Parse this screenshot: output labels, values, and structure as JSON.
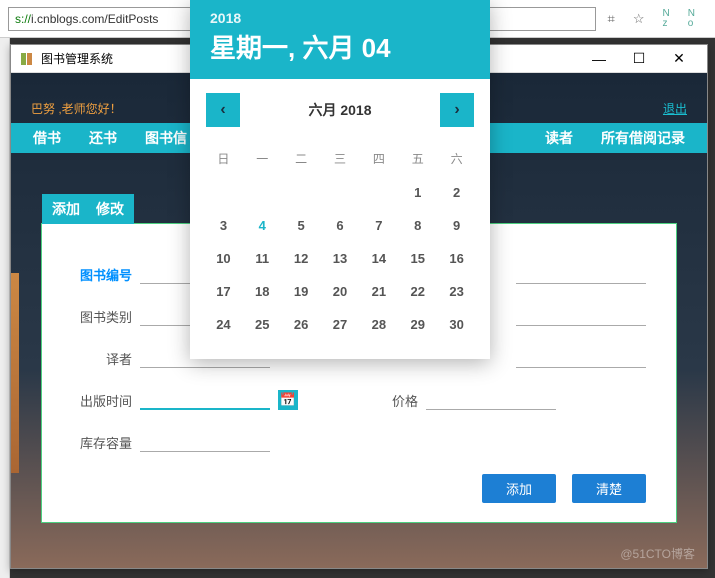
{
  "browser": {
    "url_prefix": "s://",
    "url_host": "i.cnblogs.com",
    "url_path": "/EditPosts",
    "qr_icon": "⌗",
    "star_icon": "☆"
  },
  "window": {
    "title": "图书管理系统"
  },
  "header": {
    "greeting": "巴努 ,老师您好！",
    "logout": "退出"
  },
  "nav": [
    "借书",
    "还书",
    "图书信",
    "读者",
    "所有借阅记录"
  ],
  "panel": {
    "tabs": [
      "添加",
      "修改"
    ],
    "fields": {
      "book_id": "图书编号",
      "category": "图书类别",
      "translator": "译者",
      "pub_date": "出版时间",
      "price": "价格",
      "stock": "库存容量"
    },
    "buttons": {
      "add": "添加",
      "clear": "清楚"
    }
  },
  "datepicker": {
    "year": "2018",
    "display_date": "星期一, 六月 04",
    "month_label": "六月 2018",
    "dow": [
      "日",
      "一",
      "二",
      "三",
      "四",
      "五",
      "六"
    ],
    "weeks": [
      [
        "",
        "",
        "",
        "",
        "",
        "1",
        "2"
      ],
      [
        "3",
        "4",
        "5",
        "6",
        "7",
        "8",
        "9"
      ],
      [
        "10",
        "11",
        "12",
        "13",
        "14",
        "15",
        "16"
      ],
      [
        "17",
        "18",
        "19",
        "20",
        "21",
        "22",
        "23"
      ],
      [
        "24",
        "25",
        "26",
        "27",
        "28",
        "29",
        "30"
      ]
    ],
    "selected": "4"
  },
  "watermark": "@51CTO博客"
}
